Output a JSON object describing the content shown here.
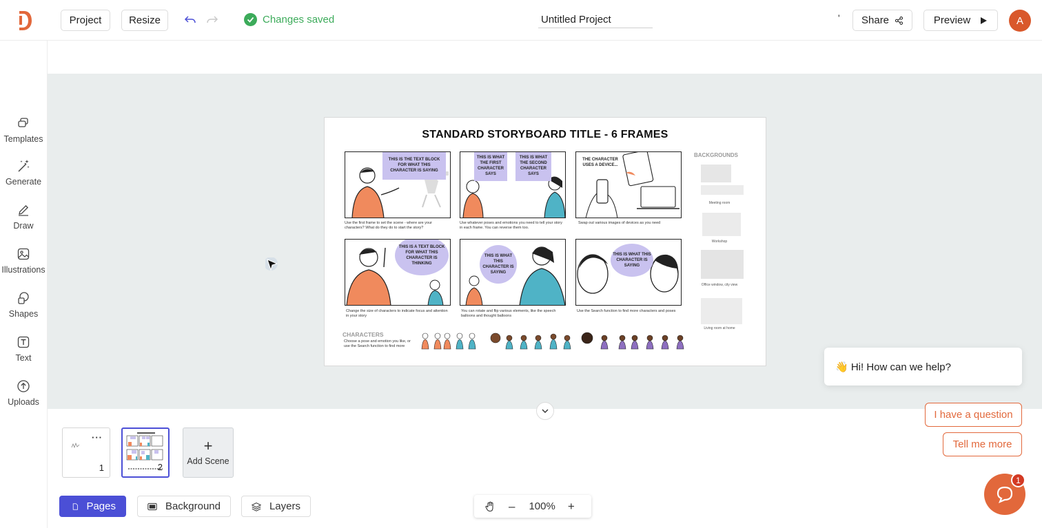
{
  "topbar": {
    "project_label": "Project",
    "resize_label": "Resize",
    "status_text": "Changes saved",
    "project_title": "Untitled Project",
    "tick_text": "'",
    "share_label": "Share",
    "preview_label": "Preview",
    "avatar_initial": "A"
  },
  "sidebar": {
    "items": [
      {
        "label": "Templates",
        "icon": "templates-icon"
      },
      {
        "label": "Generate",
        "icon": "magic-wand-icon"
      },
      {
        "label": "Draw",
        "icon": "pencil-icon"
      },
      {
        "label": "Illustrations",
        "icon": "image-icon"
      },
      {
        "label": "Shapes",
        "icon": "shapes-icon"
      },
      {
        "label": "Text",
        "icon": "text-icon"
      },
      {
        "label": "Uploads",
        "icon": "upload-icon"
      }
    ]
  },
  "board": {
    "title": "STANDARD STORYBOARD TITLE - 6 FRAMES",
    "bubbles": [
      "THIS IS THE TEXT BLOCK FOR WHAT THIS CHARACTER IS SAYING",
      "THIS IS WHAT THE FIRST CHARACTER SAYS",
      "THIS IS WHAT THE SECOND CHARACTER SAYS",
      "THE CHARACTER USES A DEVICE...",
      "THIS IS A TEXT BLOCK FOR WHAT THIS CHARACTER IS THINKING",
      "THIS IS WHAT THIS CHARACTER IS SAYING",
      "THIS IS WHAT THIS CHARACTER IS SAYING"
    ],
    "captions": [
      "Use the first frame to set the scene - where are your characters? What do they do to start the story?",
      "Use whatever poses and emotions you need to tell your story in each frame. You can reverse them too.",
      "Swap out various images of devices as you need",
      "Change the size of characters to indicate focus and attention in your story",
      "You can rotate and flip various elements, like the speech balloons and thought balloons",
      "Use the Search function to find more characters and poses"
    ],
    "backgrounds_title": "BACKGROUNDS",
    "backgrounds": [
      "Meeting room",
      "Workshop",
      "Office window, city view",
      "Living room at home"
    ],
    "characters_title": "CHARACTERS",
    "characters_caption": "Choose a pose and emotion you like, or use the Search function to find more"
  },
  "scenes": [
    {
      "number": "1"
    },
    {
      "number": "2"
    }
  ],
  "add_scene_label": "Add Scene",
  "bottom": {
    "pages_label": "Pages",
    "background_label": "Background",
    "layers_label": "Layers",
    "zoom": "100%"
  },
  "chat": {
    "greeting": "👋 Hi! How can we help?",
    "question_label": "I have a question",
    "more_label": "Tell me more",
    "badge_count": "1"
  },
  "colors": {
    "accent": "#4b4fd6",
    "brand": "#e2683b",
    "success": "#3cab5a",
    "bubble": "#c9c2ef",
    "character_orange": "#f08a5d",
    "character_teal": "#4fb3c6"
  }
}
